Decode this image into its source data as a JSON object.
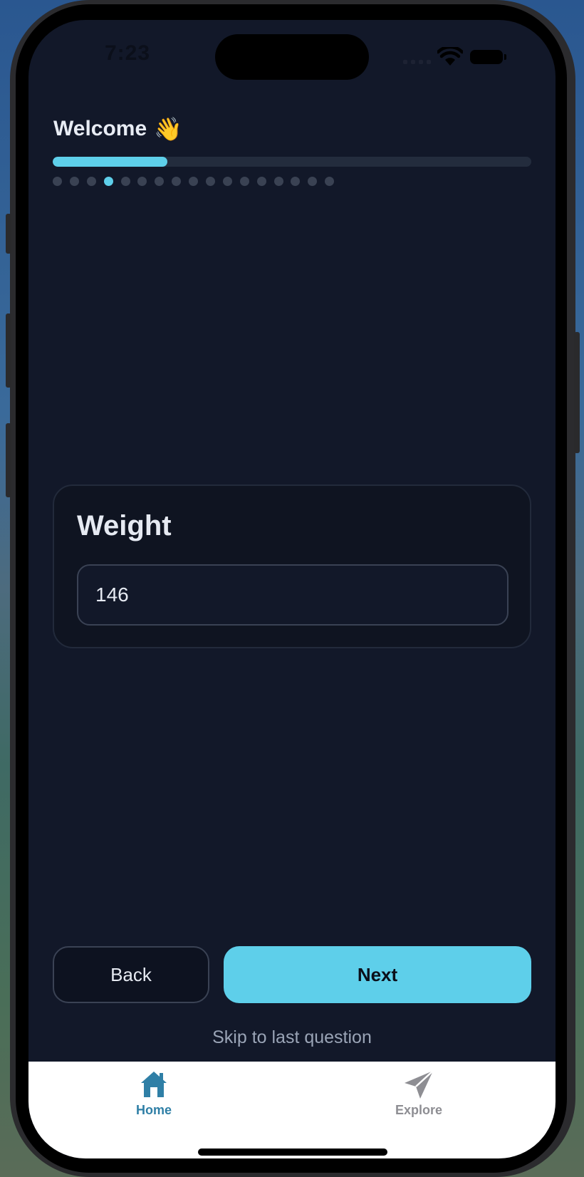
{
  "status_bar": {
    "time": "7:23"
  },
  "header": {
    "title": "Welcome",
    "title_emoji": "👋"
  },
  "progress": {
    "fraction": 0.24,
    "total_steps": 17,
    "current_step": 4
  },
  "question": {
    "label": "Weight",
    "input_value": "146"
  },
  "actions": {
    "back_label": "Back",
    "next_label": "Next",
    "skip_label": "Skip to last question"
  },
  "tabbar": {
    "items": [
      {
        "label": "Home",
        "icon": "home-icon",
        "active": true
      },
      {
        "label": "Explore",
        "icon": "send-icon",
        "active": false
      }
    ]
  },
  "colors": {
    "accent": "#5ecfea",
    "background": "#121829",
    "card": "#0f1421",
    "tab_active": "#2f7fa6",
    "tab_inactive": "#8e8e93"
  }
}
